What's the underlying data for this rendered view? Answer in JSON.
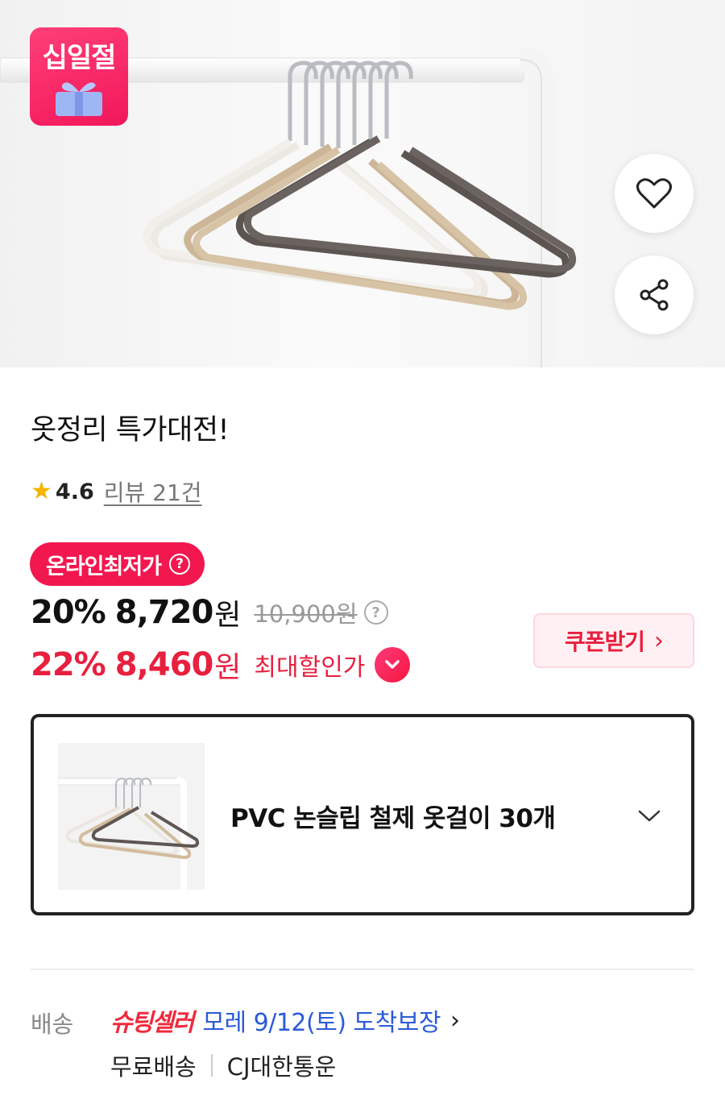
{
  "hero": {
    "badge_text": "십일절",
    "like_icon": "heart-icon",
    "share_icon": "share-icon"
  },
  "product": {
    "title": "옷정리 특가대전!",
    "rating": {
      "star_icon": "star-icon",
      "score": "4.6",
      "review_text": "리뷰 21건",
      "stars_fraction": 0.92
    }
  },
  "pricing": {
    "lowest_label": "온라인최저가",
    "help_icon_text": "?",
    "discount_percent": "20%",
    "sale_price": "8,720",
    "currency": "원",
    "original_price": "10,900원",
    "max_discount_percent": "22%",
    "max_price": "8,460",
    "max_label": "최대할인가",
    "coupon_label": "쿠폰받기",
    "coupon_arrow": "›"
  },
  "option": {
    "name": "PVC 논슬립 철제 옷걸이 30개",
    "chevron_icon": "chevron-down-icon"
  },
  "delivery": {
    "label": "배송",
    "service_logo": "슈팅셀러",
    "arrival": "모레 9/12(토) 도착보장",
    "arrow": "›",
    "fee": "무료배송",
    "carrier": "CJ대한통운"
  },
  "colors": {
    "accent_red": "#e8203f",
    "badge_pink": "#f2184f",
    "link_blue": "#2a5bd7",
    "star_yellow": "#f4b400"
  }
}
